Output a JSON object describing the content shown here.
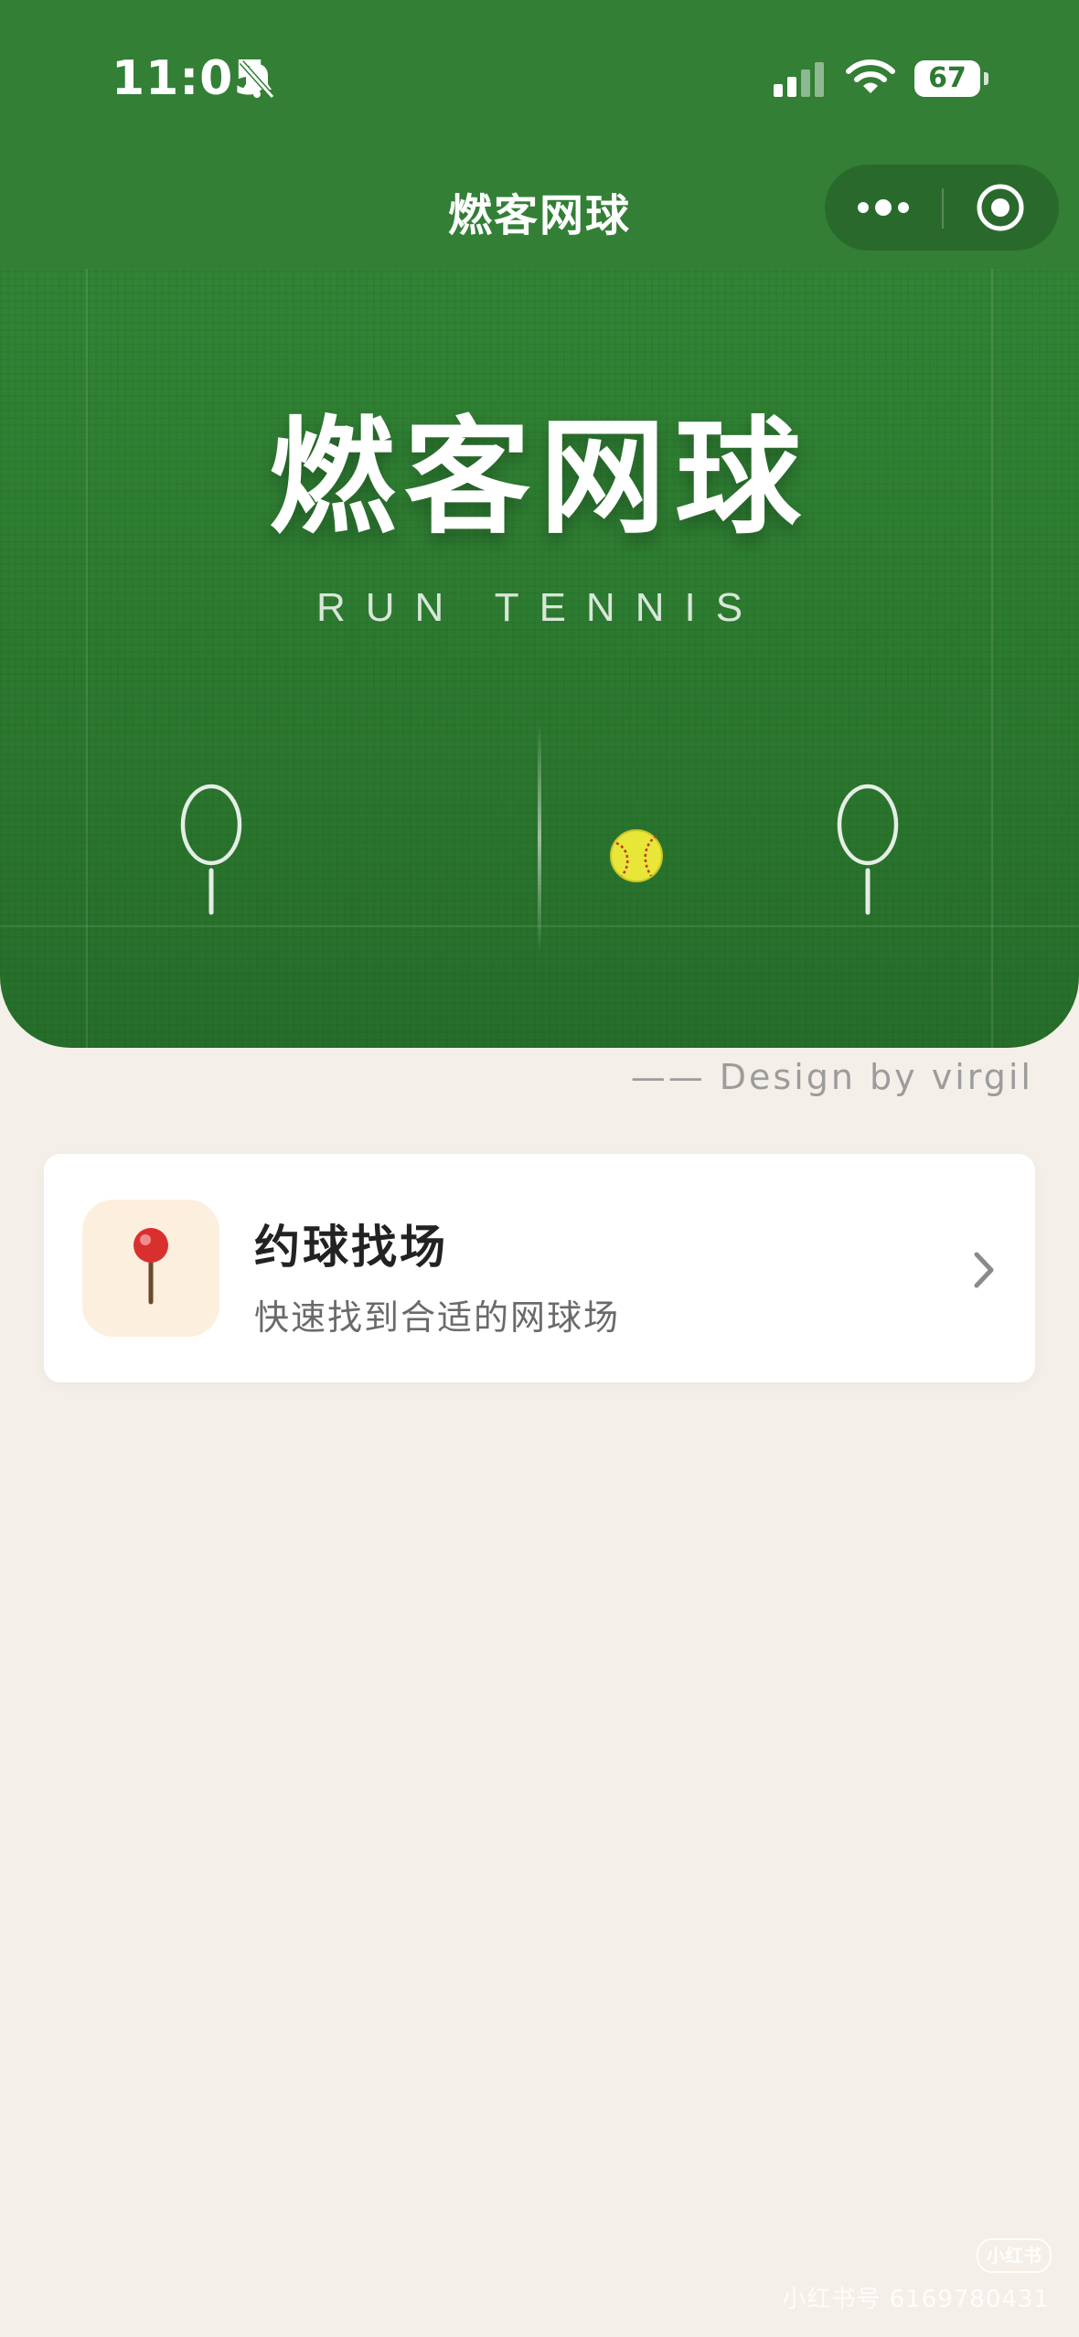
{
  "status_bar": {
    "time": "11:05",
    "battery": "67",
    "icons": [
      "bell-slash-icon",
      "cellular-signal-icon",
      "wifi-icon",
      "battery-icon"
    ]
  },
  "nav": {
    "title": "燃客网球",
    "capsule": {
      "more_icon": "more-dots-icon",
      "close_icon": "target-circle-icon"
    }
  },
  "hero": {
    "title": "燃客网球",
    "subtitle": "RUN TENNIS",
    "decorations": [
      "racket-icon",
      "tennis-ball-icon",
      "racket-icon"
    ]
  },
  "credit": "—— Design by virgil",
  "feature_card": {
    "icon": "pushpin-icon",
    "title": "约球找场",
    "subtitle": "快速找到合适的网球场",
    "arrow": "chevron-right-icon"
  },
  "watermark": {
    "logo": "小红书",
    "text": "小红书号 6169780431"
  },
  "colors": {
    "brand_green": "#327f35",
    "background": "#f4efe8",
    "card": "#ffffff",
    "icon_box": "#fdefde"
  }
}
